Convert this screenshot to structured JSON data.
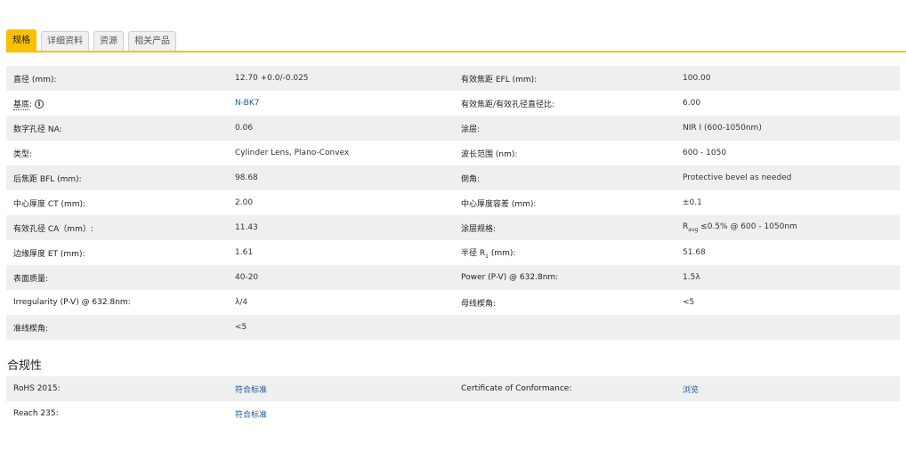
{
  "tabs": [
    "规格",
    "详细资料",
    "资源",
    "相关产品"
  ],
  "spec_rows": [
    {
      "l1": "直径 (mm):",
      "v1": "12.70 +0.0/-0.025",
      "l2": "有效焦距 EFL (mm):",
      "v2": "100.00"
    },
    {
      "l1": "基底",
      "v1": "N-BK7",
      "l2": "有效焦距/有效孔径直径比:",
      "v2": "6.00"
    },
    {
      "l1": "数字孔径 NA:",
      "v1": "0.06",
      "l2": "涂层:",
      "v2": "NIR I (600-1050nm)"
    },
    {
      "l1": "类型:",
      "v1": "Cylinder Lens, Plano-Convex",
      "l2": "波长范围 (nm):",
      "v2": "600 - 1050"
    },
    {
      "l1": "后焦距 BFL (mm):",
      "v1": "98.68",
      "l2": "倒角:",
      "v2": "Protective bevel as needed"
    },
    {
      "l1": "中心厚度 CT (mm):",
      "v1": "2.00",
      "l2": "中心厚度容差 (mm):",
      "v2": "±0.1"
    },
    {
      "l1": "有效孔径 CA（mm）:",
      "v1": "11.43",
      "l2": "涂层规格:",
      "v2": "R",
      "v2_sub": "avg",
      "v2_rest": " ≤0.5% @ 600 - 1050nm"
    },
    {
      "l1": "边缘厚度 ET (mm):",
      "v1": "1.61",
      "l2": "半径 R",
      "l2_sub": "1",
      "l2_rest": " (mm):",
      "v2": "51.68"
    },
    {
      "l1": "表面质量:",
      "v1": "40-20",
      "l2": "Power (P-V) @ 632.8nm:",
      "v2": "1.5λ"
    },
    {
      "l1": "Irregularity (P-V) @ 632.8nm:",
      "v1": "λ/4",
      "l2": "母线楔角:",
      "v2": "<5"
    },
    {
      "l1": "准线楔角:",
      "v1": "<5",
      "l2": "",
      "v2": ""
    }
  ],
  "substrate_suffix": ":",
  "compliance": {
    "title": "合规性",
    "rows": [
      {
        "l1": "RoHS 2015:",
        "v1": "符合标准",
        "l2": "Certificate of Conformance:",
        "v2": "浏览"
      },
      {
        "l1": "Reach 235:",
        "v1": "符合标准",
        "l2": "",
        "v2": ""
      }
    ]
  },
  "colors": {
    "accent": "#f8c100",
    "link": "#1f5a96",
    "row_alt": "#efefef"
  },
  "icons": {
    "info": "info-circle-icon"
  }
}
